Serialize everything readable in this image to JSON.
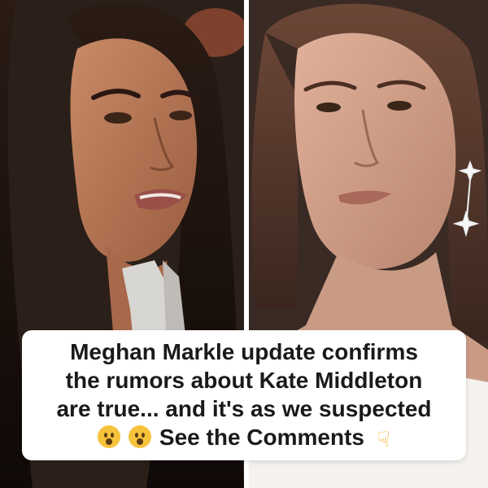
{
  "caption": {
    "line1": "Meghan Markle update confirms",
    "line2": "the rumors about Kate Middleton",
    "line3": "are true... and it's as we suspected",
    "line4_text": "See the Comments",
    "emoji_faces": [
      "hushed-face",
      "hushed-face"
    ],
    "pointer_icon": "backhand-index-pointing-down"
  },
  "colors": {
    "card_background": "#ffffff",
    "caption_text": "#1a1a1a",
    "divider": "#ffffff"
  }
}
